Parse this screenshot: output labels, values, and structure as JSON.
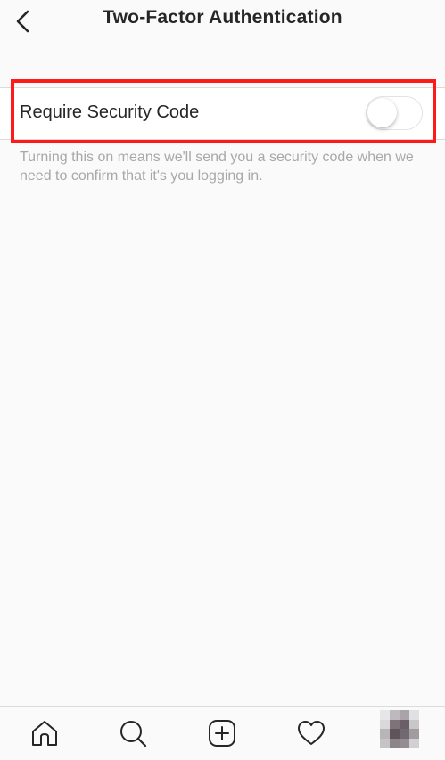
{
  "header": {
    "title": "Two-Factor Authentication",
    "back_icon": "chevron-left-icon"
  },
  "setting": {
    "label": "Require Security Code",
    "toggle_on": false,
    "description": "Turning this on means we'll send you a security code when we need to confirm that it's you logging in."
  },
  "annotation": {
    "highlight_color": "#ff1a1a"
  },
  "tab_bar": {
    "tabs": [
      {
        "icon": "home-icon"
      },
      {
        "icon": "search-icon"
      },
      {
        "icon": "new-post-icon"
      },
      {
        "icon": "activity-heart-icon"
      },
      {
        "icon": "profile-avatar"
      }
    ]
  },
  "colors": {
    "background": "#fafafa",
    "divider": "#dbdbdb",
    "secondary_text": "#a8a8a8"
  }
}
